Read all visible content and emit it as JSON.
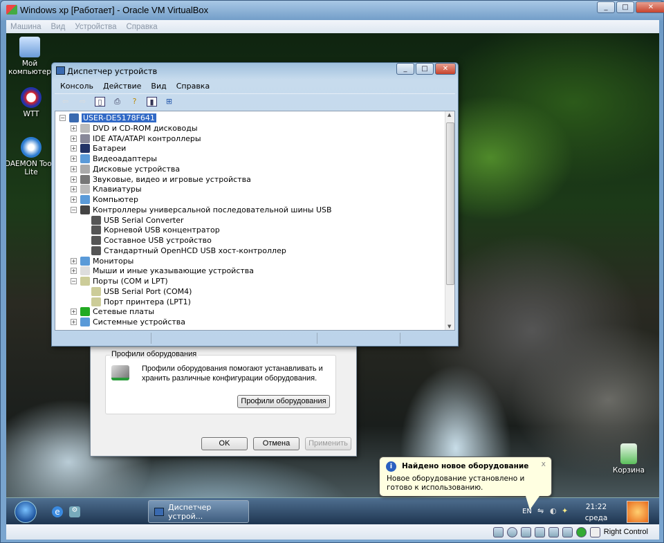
{
  "vbox": {
    "title": "Windows xp [Работает] - Oracle VM VirtualBox",
    "menu": [
      "Машина",
      "Вид",
      "Устройства",
      "Справка"
    ],
    "host_key": "Right Control"
  },
  "desktop": {
    "icons": [
      "Мой компьютер",
      "WTT",
      "DAEMON Tools Lite",
      "Корзина"
    ]
  },
  "devmgr": {
    "title": "Диспетчер устройств",
    "menu": [
      "Консоль",
      "Действие",
      "Вид",
      "Справка"
    ],
    "tree": {
      "root": "USER-DE5178F641",
      "items": [
        {
          "label": "DVD и CD-ROM дисководы",
          "expanded": false,
          "children": []
        },
        {
          "label": "IDE ATA/ATAPI контроллеры",
          "expanded": false,
          "children": []
        },
        {
          "label": "Батареи",
          "expanded": false,
          "children": []
        },
        {
          "label": "Видеоадаптеры",
          "expanded": false,
          "children": []
        },
        {
          "label": "Дисковые устройства",
          "expanded": false,
          "children": []
        },
        {
          "label": "Звуковые, видео и игровые устройства",
          "expanded": false,
          "children": []
        },
        {
          "label": "Клавиатуры",
          "expanded": false,
          "children": []
        },
        {
          "label": "Компьютер",
          "expanded": false,
          "children": []
        },
        {
          "label": "Контроллеры универсальной последовательной шины USB",
          "expanded": true,
          "children": [
            "USB Serial Converter",
            "Корневой USB концентратор",
            "Составное USB устройство",
            "Стандартный OpenHCD USB хост-контроллер"
          ]
        },
        {
          "label": "Мониторы",
          "expanded": false,
          "children": []
        },
        {
          "label": "Мыши и иные указывающие устройства",
          "expanded": false,
          "children": []
        },
        {
          "label": "Порты (COM и LPT)",
          "expanded": true,
          "children": [
            "USB Serial Port (COM4)",
            "Порт принтера (LPT1)"
          ]
        },
        {
          "label": "Сетевые платы",
          "expanded": false,
          "children": []
        },
        {
          "label": "Системные устройства",
          "expanded": false,
          "children": []
        }
      ]
    }
  },
  "props": {
    "group_title": "Профили оборудования",
    "group_text": "Профили оборудования помогают устанавливать и хранить различные конфигурации оборудования.",
    "profiles_button": "Профили оборудования",
    "ok": "OK",
    "cancel": "Отмена",
    "apply": "Применить"
  },
  "balloon": {
    "title": "Найдено новое оборудование",
    "text": "Новое оборудование установлено и готово к использованию.",
    "close": "x"
  },
  "taskbar": {
    "task": "Диспетчер устрой...",
    "lang": "EN",
    "time": "21:22",
    "day": "среда"
  }
}
